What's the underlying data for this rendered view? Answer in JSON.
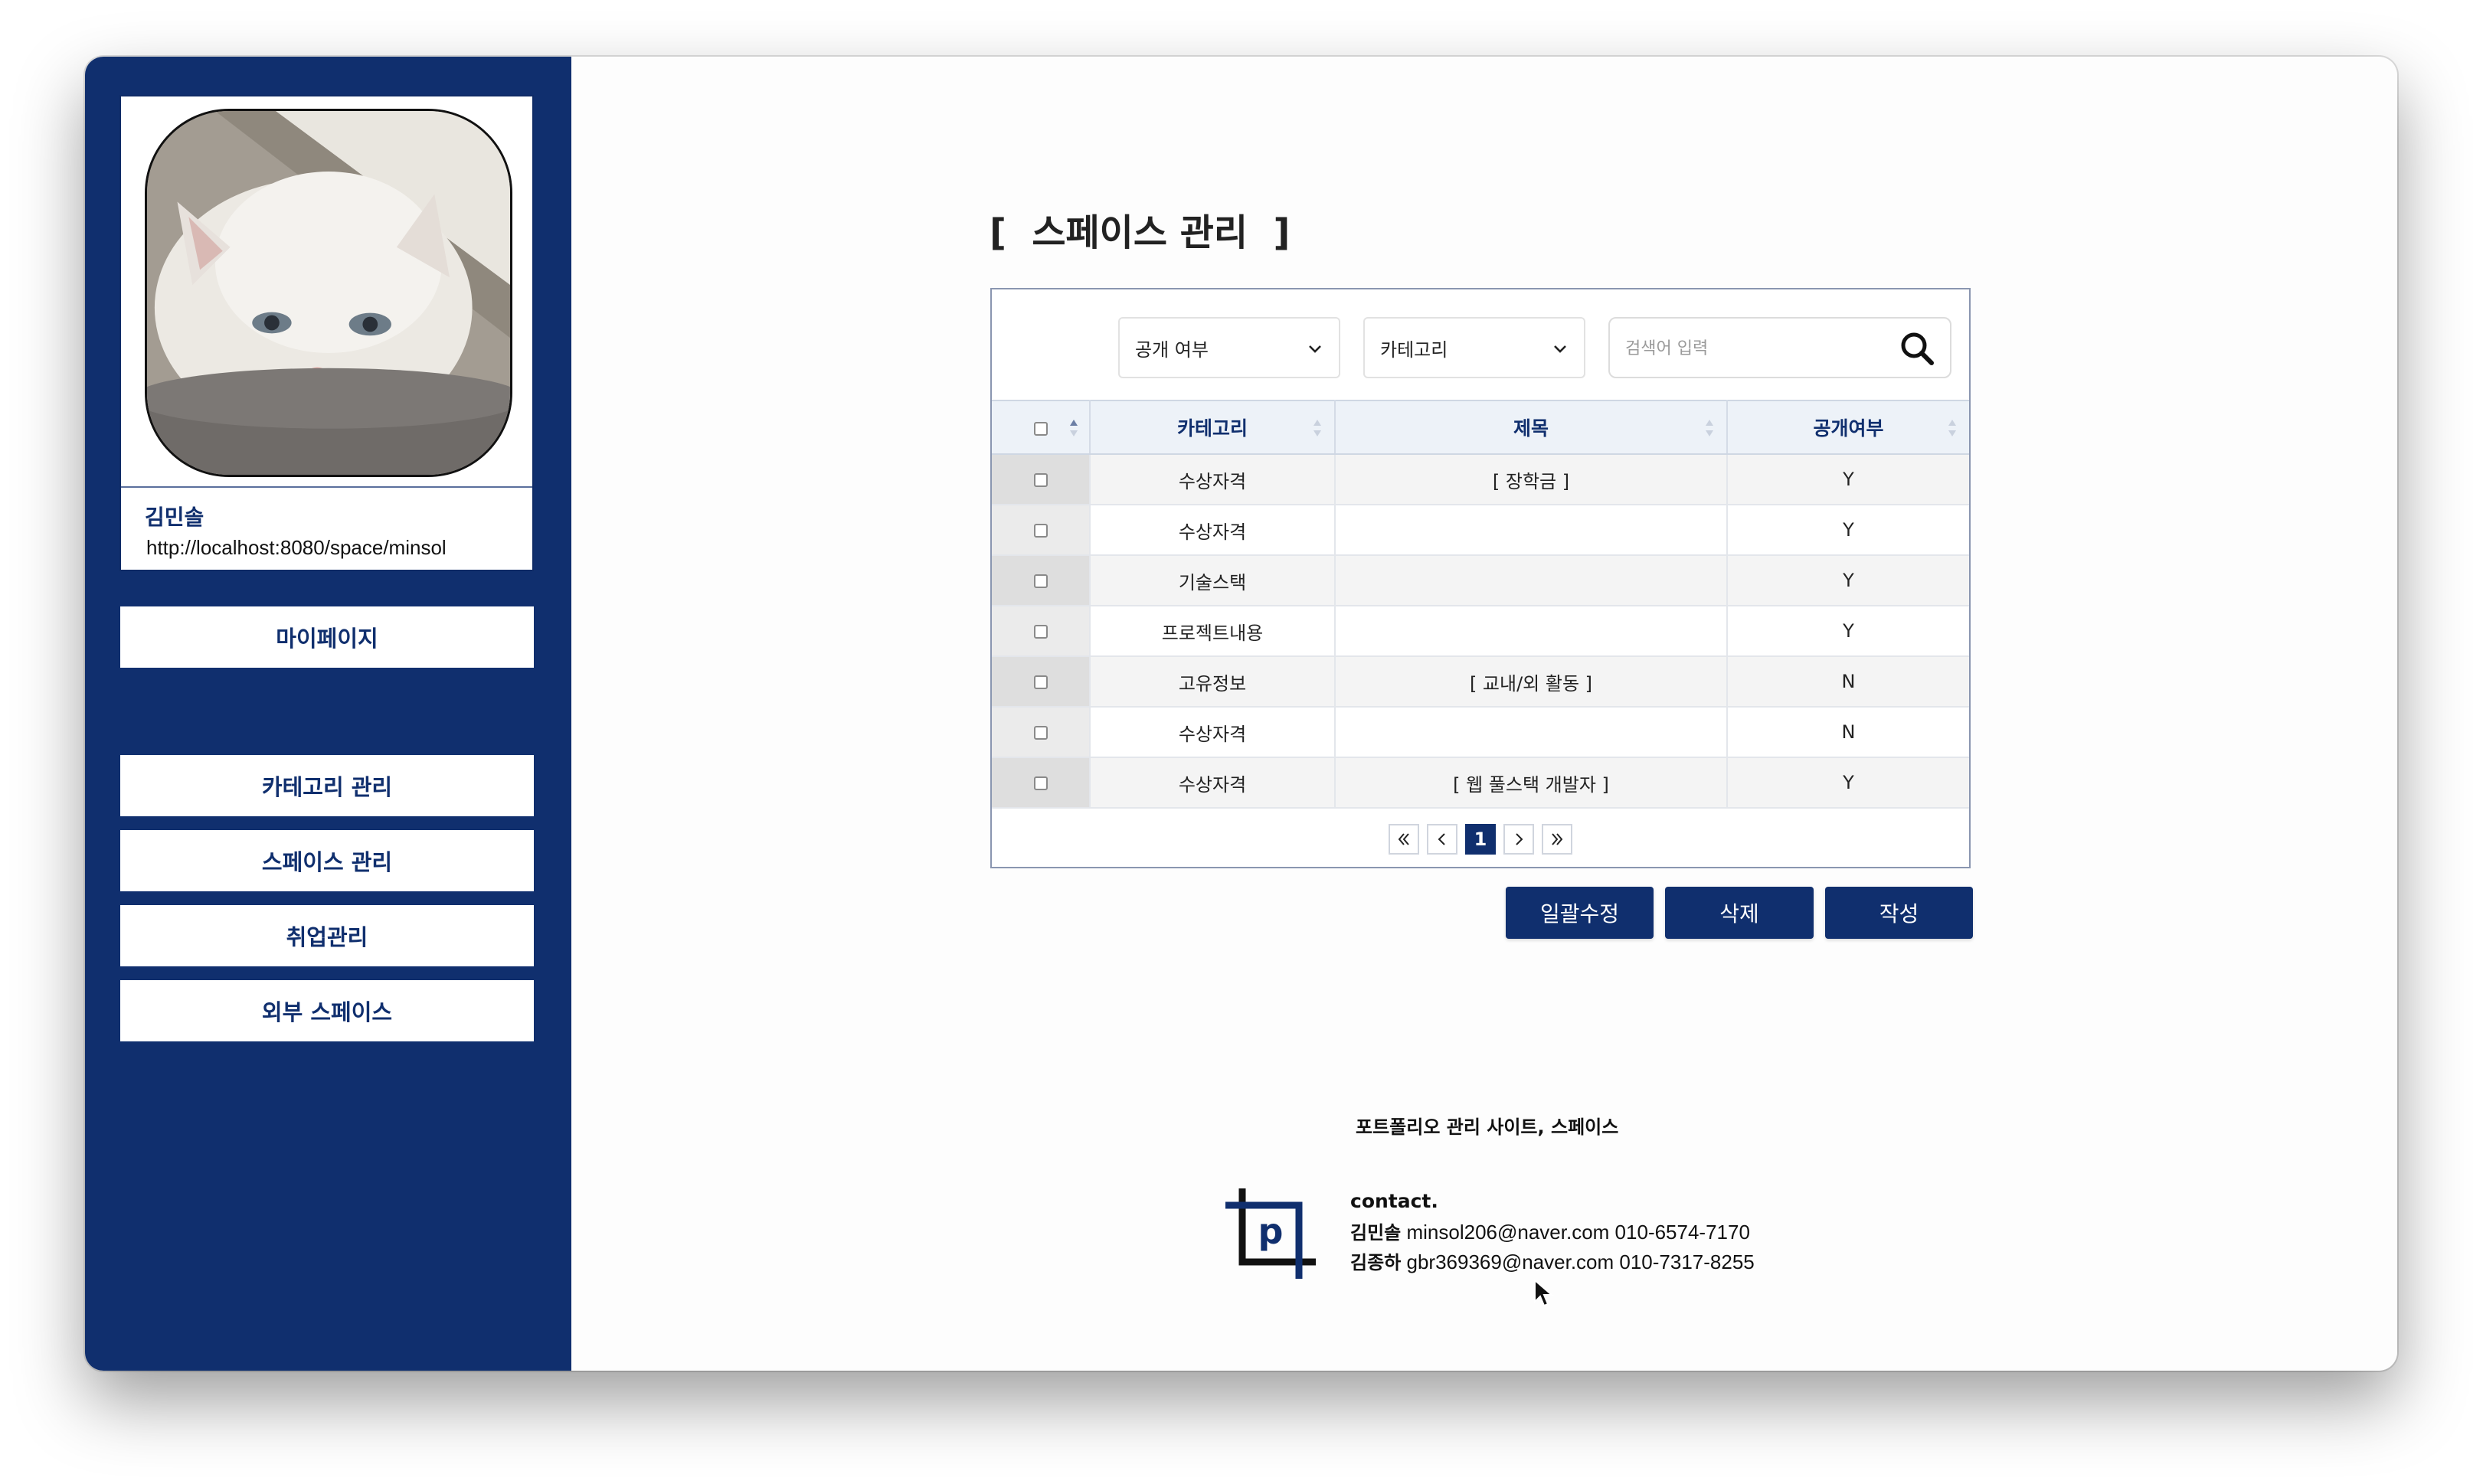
{
  "sidebar": {
    "profile": {
      "name": "김민솔",
      "url": "http://localhost:8080/space/minsol"
    },
    "mypage_label": "마이페이지",
    "menu": [
      {
        "label": "카테고리 관리"
      },
      {
        "label": "스페이스 관리"
      },
      {
        "label": "취업관리"
      },
      {
        "label": "외부 스페이스"
      }
    ]
  },
  "main": {
    "title": "[  스페이스 관리  ]",
    "filters": {
      "visibility": "공개 여부",
      "category": "카테고리",
      "search_placeholder": "검색어 입력"
    },
    "table": {
      "headers": [
        "카테고리",
        "제목",
        "공개여부"
      ],
      "rows": [
        {
          "category": "수상자격",
          "title": "[ 장학금 ]",
          "public": "Y"
        },
        {
          "category": "수상자격",
          "title": "",
          "public": "Y"
        },
        {
          "category": "기술스택",
          "title": "",
          "public": "Y"
        },
        {
          "category": "프로젝트내용",
          "title": "",
          "public": "Y"
        },
        {
          "category": "고유정보",
          "title": "[ 교내/외 활동 ]",
          "public": "N"
        },
        {
          "category": "수상자격",
          "title": "",
          "public": "N"
        },
        {
          "category": "수상자격",
          "title": "[ 웹 풀스택 개발자 ]",
          "public": "Y"
        }
      ]
    },
    "pagination": {
      "current": "1"
    },
    "actions": {
      "bulk_edit": "일괄수정",
      "delete": "삭제",
      "write": "작성"
    }
  },
  "footer": {
    "site_title": "포트폴리오 관리 사이트, 스페이스",
    "logo_letter": "p",
    "contact_head": "contact.",
    "contacts": [
      {
        "name": "김민솔",
        "info": "minsol206@naver.com 010-6574-7170"
      },
      {
        "name": "김종하",
        "info": "gbr369369@naver.com 010-7317-8255"
      }
    ]
  },
  "colors": {
    "brand_navy": "#102f6e",
    "header_bg": "#edf2f8"
  },
  "icons": [
    "chevron-down-icon",
    "search-icon",
    "sort-icon",
    "double-chevron-left-icon",
    "chevron-left-icon",
    "chevron-right-icon",
    "double-chevron-right-icon",
    "crop-logo-icon",
    "mouse-cursor-icon"
  ]
}
